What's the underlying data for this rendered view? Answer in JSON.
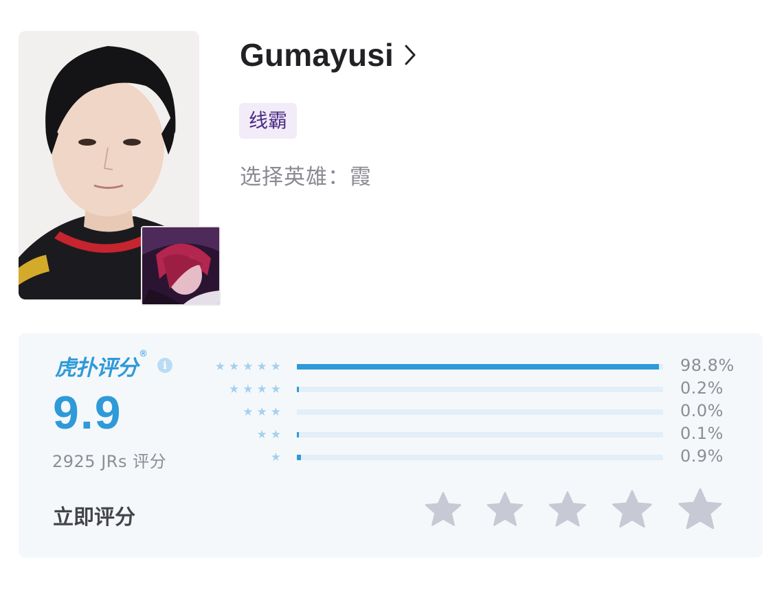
{
  "player": {
    "name": "Gumayusi",
    "tag": "线霸",
    "hero_line": "选择英雄：霞"
  },
  "icons": {
    "chevron": "chevron-right-icon",
    "info": "info-icon",
    "star": "star-icon"
  },
  "rating": {
    "brand": "虎扑评分",
    "brand_mark": "®",
    "info_glyph": "i",
    "score": "9.9",
    "count_label": "2925 JRs 评分",
    "distribution": [
      {
        "stars": 5,
        "percent_label": "98.8%",
        "fraction": 0.988
      },
      {
        "stars": 4,
        "percent_label": "0.2%",
        "fraction": 0.002
      },
      {
        "stars": 3,
        "percent_label": "0.0%",
        "fraction": 0.0
      },
      {
        "stars": 2,
        "percent_label": "0.1%",
        "fraction": 0.001
      },
      {
        "stars": 1,
        "percent_label": "0.9%",
        "fraction": 0.009
      }
    ],
    "rate_now_label": "立即评分",
    "rate_star_count": 5
  },
  "colors": {
    "accent": "#2f9ad8",
    "bar_track": "#e2eef8",
    "star_light": "#a5d1ee",
    "star_empty": "#c7c9d4",
    "tag_bg": "#f1ecf7",
    "tag_text": "#4b2a86"
  }
}
